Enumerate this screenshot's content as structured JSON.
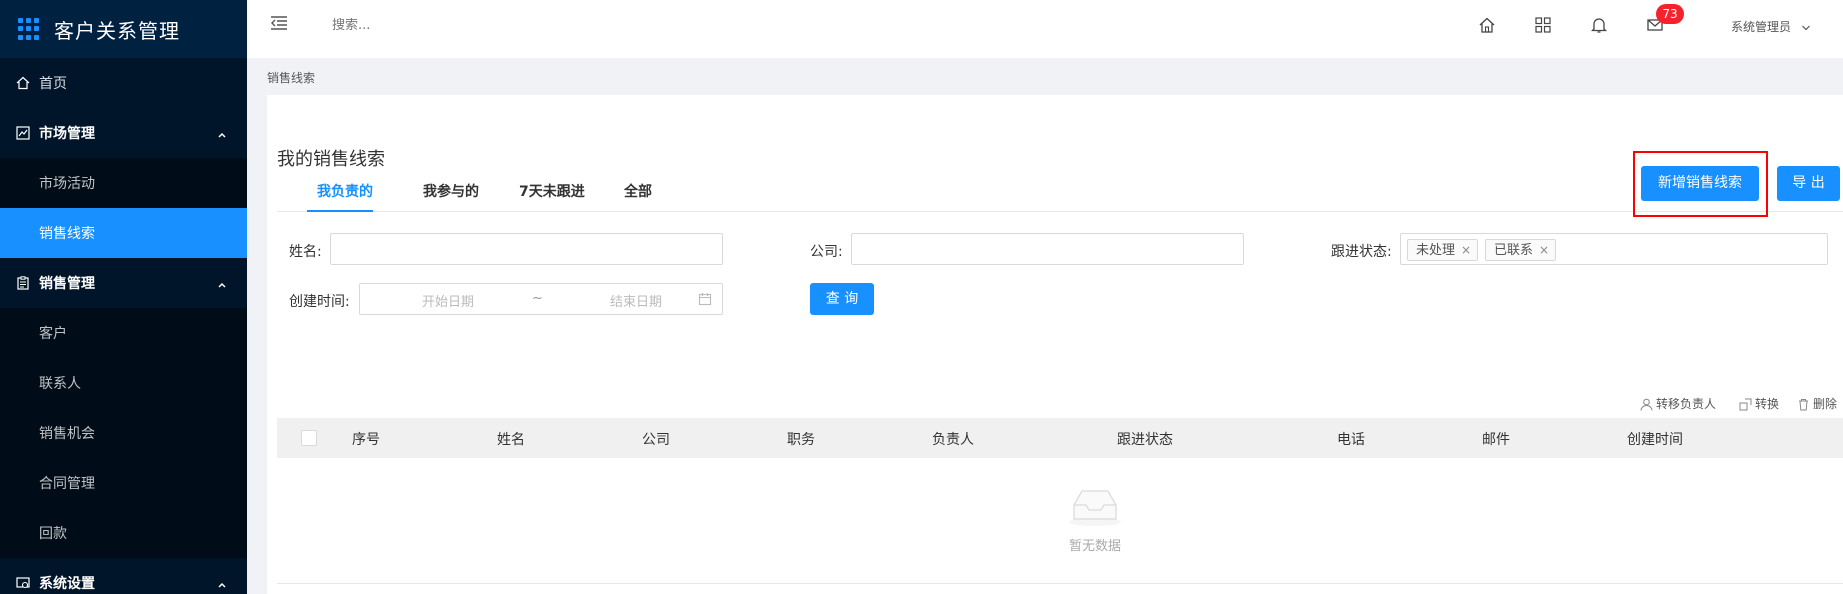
{
  "app": {
    "title": "客户关系管理"
  },
  "sidebar": {
    "items": [
      {
        "label": "首页"
      },
      {
        "label": "市场管理",
        "children": [
          "市场活动",
          "销售线索"
        ]
      },
      {
        "label": "销售管理",
        "children": [
          "客户",
          "联系人",
          "销售机会",
          "合同管理",
          "回款"
        ]
      },
      {
        "label": "系统设置"
      }
    ],
    "active": "销售线索"
  },
  "header": {
    "search_placeholder": "搜索...",
    "badge_count": "73",
    "user": "系统管理员"
  },
  "breadcrumb": "销售线索",
  "page": {
    "title": "我的销售线索",
    "tabs": [
      "我负责的",
      "我参与的",
      "7天未跟进",
      "全部"
    ],
    "active_tab": "我负责的",
    "buttons": {
      "add": "新增销售线索",
      "export": "导 出",
      "query": "查 询"
    }
  },
  "filters": {
    "name_label": "姓名:",
    "company_label": "公司:",
    "status_label": "跟进状态:",
    "status_tags": [
      "未处理",
      "已联系"
    ],
    "created_label": "创建时间:",
    "start_placeholder": "开始日期",
    "range_sep": "~",
    "end_placeholder": "结束日期"
  },
  "table": {
    "actions": [
      "转移负责人",
      "转换",
      "删除"
    ],
    "columns": [
      "序号",
      "姓名",
      "公司",
      "职务",
      "负责人",
      "跟进状态",
      "电话",
      "邮件",
      "创建时间"
    ],
    "empty_text": "暂无数据"
  },
  "colors": {
    "primary": "#1890ff",
    "sidebar": "#001529",
    "highlight": "#ff0000",
    "badge": "#f5222d"
  }
}
